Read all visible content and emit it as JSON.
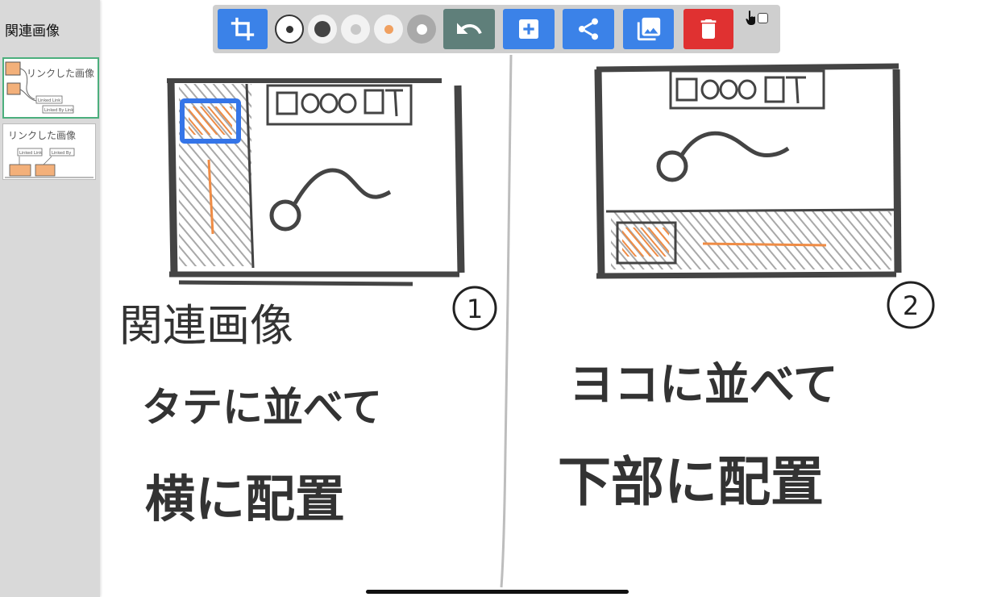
{
  "sidebar": {
    "title": "関連画像",
    "thumbnails": [
      {
        "label": "リンクした画像",
        "link_labels": [
          "Linked Link",
          "Linked By Link"
        ],
        "selected": true
      },
      {
        "label": "リンクした画像",
        "link_labels": [
          "Linked Link",
          "Linked By"
        ],
        "selected": false
      }
    ]
  },
  "toolbar": {
    "tools": [
      {
        "name": "crop-button",
        "icon": "crop-icon",
        "color": "#3b82e8"
      },
      {
        "name": "pen-thin-dark-button",
        "icon": "dot-icon",
        "dot_color": "#333333",
        "selected": true
      },
      {
        "name": "pen-thick-dark-button",
        "icon": "dot-icon",
        "dot_color": "#444444",
        "selected": false
      },
      {
        "name": "pen-light-gray-button",
        "icon": "dot-icon",
        "dot_color": "#c8c8c8",
        "selected": false
      },
      {
        "name": "pen-orange-button",
        "icon": "dot-icon",
        "dot_color": "#f0a060",
        "selected": false
      },
      {
        "name": "pen-white-button",
        "icon": "dot-icon",
        "dot_color": "#ffffff",
        "selected": false
      },
      {
        "name": "undo-button",
        "icon": "undo-icon",
        "color": "#5f7f7a"
      },
      {
        "name": "add-button",
        "icon": "plus-icon",
        "color": "#3b82e8"
      },
      {
        "name": "share-button",
        "icon": "share-icon",
        "color": "#3b82e8"
      },
      {
        "name": "gallery-button",
        "icon": "photo-library-icon",
        "color": "#3b82e8"
      },
      {
        "name": "delete-button",
        "icon": "trash-icon",
        "color": "#e03131"
      }
    ],
    "touch_mode": {
      "icon": "hand-pointer-icon",
      "checked": false
    }
  },
  "canvas": {
    "panels": [
      {
        "number": "1",
        "handwriting": [
          "関連画像",
          "タテに並べて",
          "横に配置"
        ]
      },
      {
        "number": "2",
        "handwriting": [
          "ヨコに並べて",
          "下部に配置"
        ]
      }
    ]
  },
  "colors": {
    "sidebar_bg": "#d9d9d9",
    "accent_blue": "#3b82e8",
    "danger_red": "#e03131",
    "sketch_ink": "#4a4a4a",
    "sketch_orange": "#f0a060",
    "selection_green": "#4caf7d"
  }
}
